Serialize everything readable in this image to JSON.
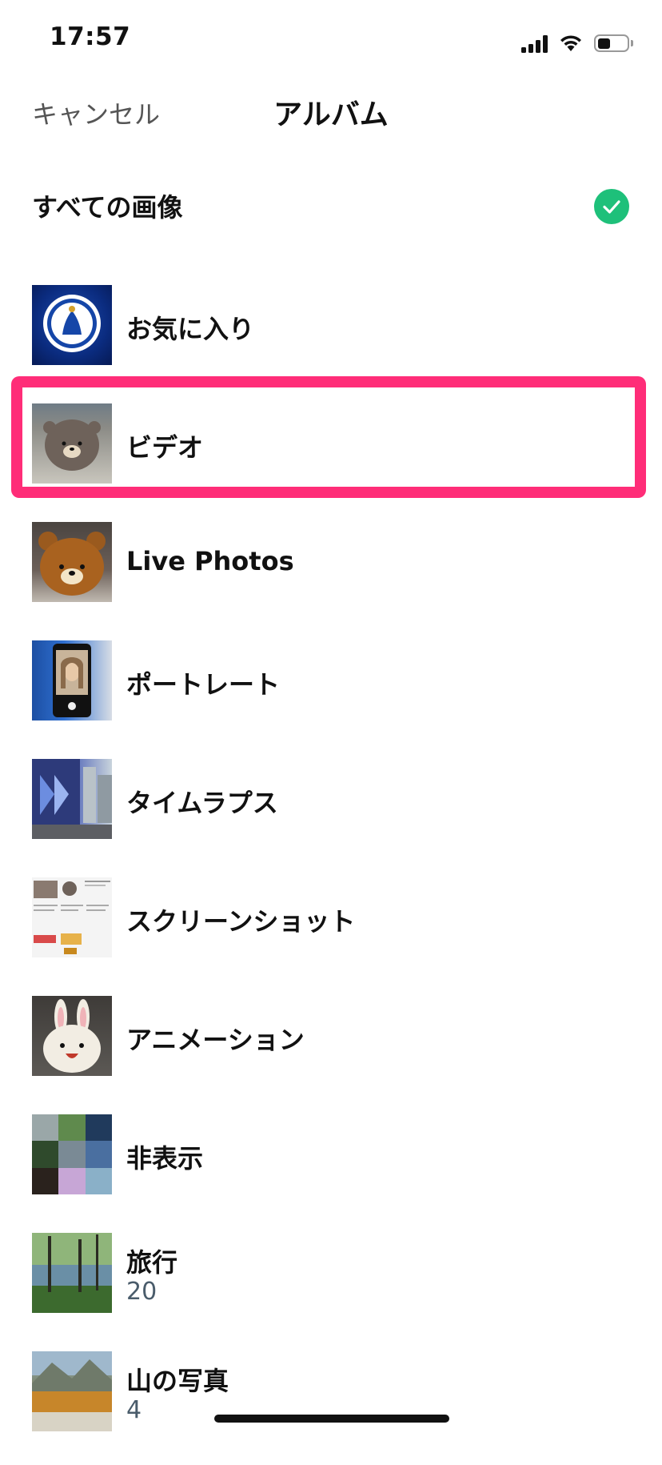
{
  "status_bar": {
    "time": "17:57",
    "battery_level": 0.45
  },
  "nav": {
    "cancel_label": "キャンセル",
    "title": "アルバム"
  },
  "all_images": {
    "label": "すべての画像",
    "selected": true,
    "accent_color": "#1ec07a"
  },
  "albums": [
    {
      "name": "お気に入り"
    },
    {
      "name": "ビデオ",
      "highlighted": true
    },
    {
      "name": "Live Photos"
    },
    {
      "name": "ポートレート"
    },
    {
      "name": "タイムラプス"
    },
    {
      "name": "スクリーンショット"
    },
    {
      "name": "アニメーション"
    },
    {
      "name": "非表示"
    },
    {
      "name": "旅行",
      "count": "20"
    },
    {
      "name": "山の写真",
      "count": "4"
    }
  ],
  "highlight_color": "#ff2d78"
}
